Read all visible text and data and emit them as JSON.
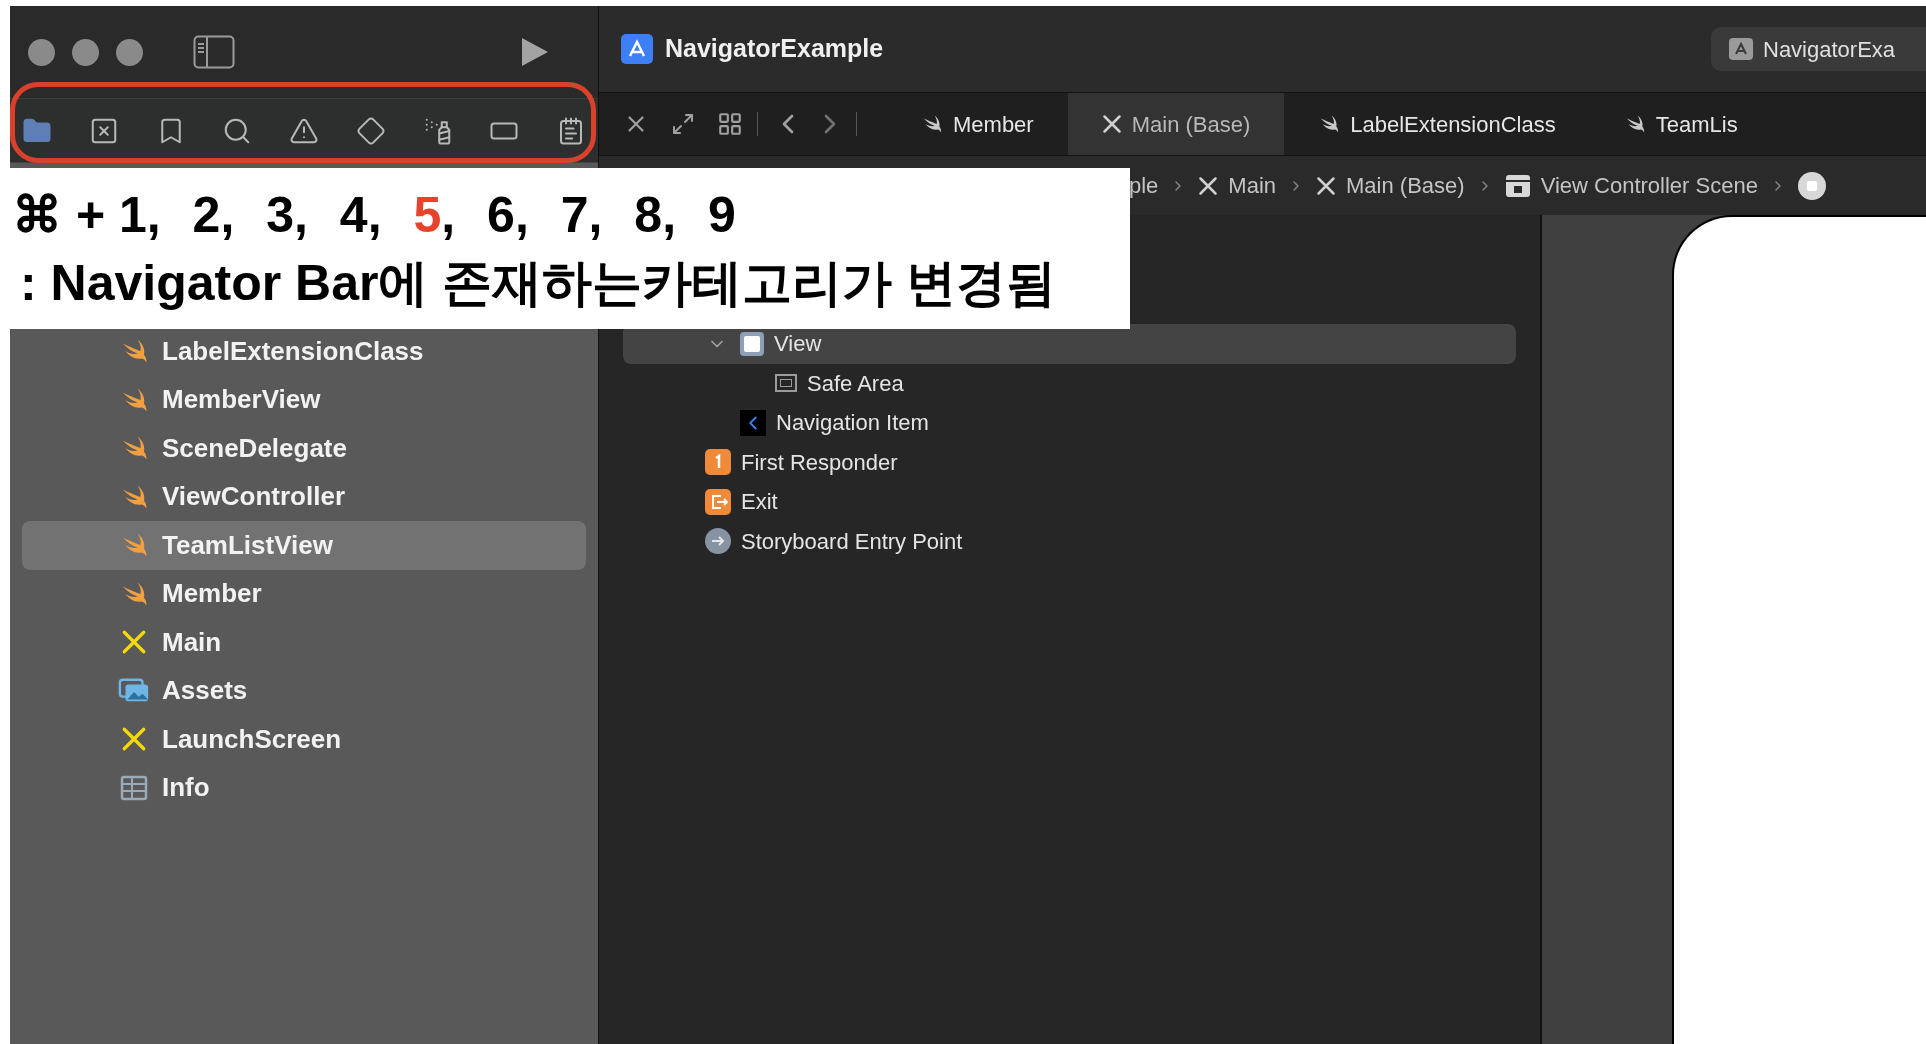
{
  "toolbar": {
    "navigator_tabs": [
      {
        "selected": true
      },
      {
        "selected": false
      },
      {
        "selected": false
      },
      {
        "selected": false
      },
      {
        "selected": false
      },
      {
        "selected": false
      },
      {
        "selected": false
      },
      {
        "selected": false
      },
      {
        "selected": false
      }
    ]
  },
  "shortcut_caption": {
    "prefix": "⌘ + ",
    "keys": [
      {
        "label": "1",
        "suffix": ",",
        "highlighted": false
      },
      {
        "label": "2",
        "suffix": ",",
        "highlighted": false
      },
      {
        "label": "3",
        "suffix": ",",
        "highlighted": false
      },
      {
        "label": "4",
        "suffix": ",",
        "highlighted": false
      },
      {
        "label": "5",
        "suffix": ",",
        "highlighted": true
      },
      {
        "label": "6",
        "suffix": ",",
        "highlighted": false
      },
      {
        "label": "7",
        "suffix": ",",
        "highlighted": false
      },
      {
        "label": "8",
        "suffix": ",",
        "highlighted": false
      },
      {
        "label": "9",
        "highlighted": false
      }
    ],
    "description": ": Navigator Bar에 존재하는카테고리가 변경됨"
  },
  "project_files": [
    {
      "label": "LabelExtensionClass",
      "kind": "swift",
      "selected": false
    },
    {
      "label": "MemberView",
      "kind": "swift",
      "selected": false
    },
    {
      "label": "SceneDelegate",
      "kind": "swift",
      "selected": false
    },
    {
      "label": "ViewController",
      "kind": "swift",
      "selected": false
    },
    {
      "label": "TeamListView",
      "kind": "swift",
      "selected": true
    },
    {
      "label": "Member",
      "kind": "swift",
      "selected": false
    },
    {
      "label": "Main",
      "kind": "storyboard",
      "selected": false
    },
    {
      "label": "Assets",
      "kind": "assets",
      "selected": false
    },
    {
      "label": "LaunchScreen",
      "kind": "storyboard",
      "selected": false
    },
    {
      "label": "Info",
      "kind": "plist",
      "selected": false
    }
  ],
  "editor": {
    "title": "NavigatorExample",
    "scheme": "NavigatorExa",
    "tabs": [
      {
        "label": "Member",
        "kind": "swift",
        "selected": false
      },
      {
        "label": "Main (Base)",
        "kind": "storyboard",
        "selected": true
      },
      {
        "label": "LabelExtensionClass",
        "kind": "swift",
        "selected": false
      },
      {
        "label": "TeamLis",
        "kind": "swift",
        "selected": false
      }
    ],
    "breadcrumb": [
      {
        "label": "ple",
        "kind": "text"
      },
      {
        "label": "Main",
        "kind": "storyboard"
      },
      {
        "label": "Main (Base)",
        "kind": "storyboard"
      },
      {
        "label": "View Controller Scene",
        "kind": "scene"
      },
      {
        "kind": "view-controller"
      }
    ],
    "outline": [
      {
        "children": [
          {
            "label": "View",
            "kind": "view",
            "expanded": true,
            "selected": true,
            "children": [
              {
                "label": "Safe Area",
                "kind": "safe-area",
                "selected": false
              }
            ]
          },
          {
            "label": "Navigation Item",
            "kind": "navigation-item",
            "selected": false
          }
        ]
      },
      {
        "label": "First Responder",
        "kind": "first-responder",
        "selected": false
      },
      {
        "label": "Exit",
        "kind": "exit",
        "selected": false
      },
      {
        "label": "Storyboard Entry Point",
        "kind": "entry-point",
        "selected": false
      }
    ]
  }
}
